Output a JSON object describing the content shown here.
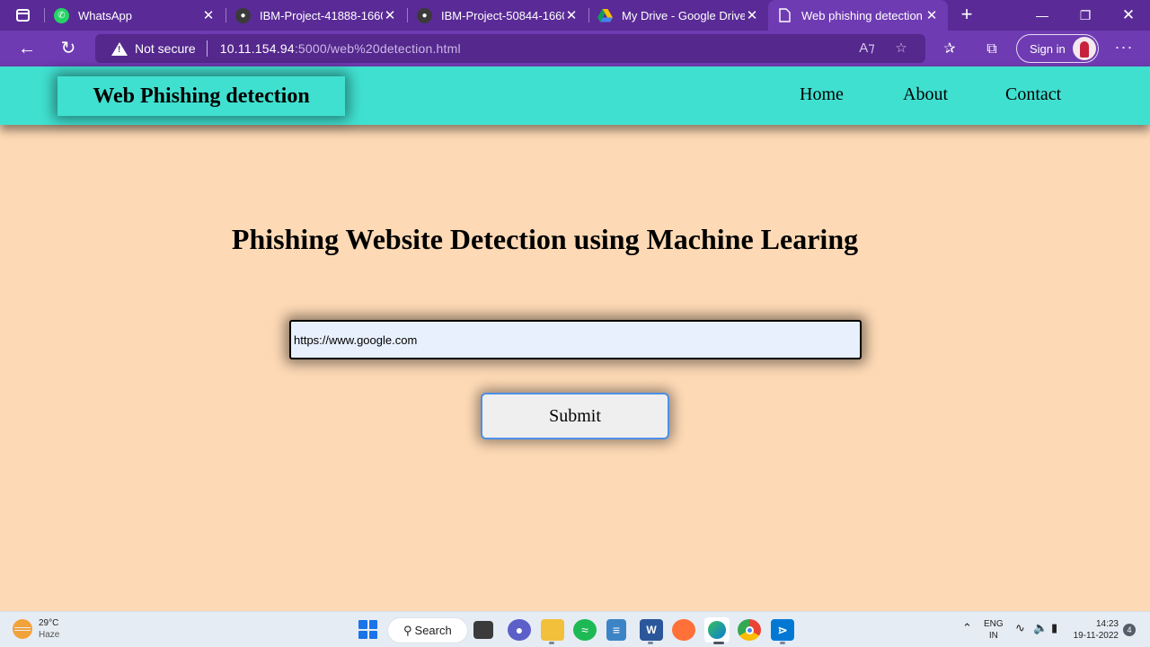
{
  "browser": {
    "tabs": [
      {
        "title": "WhatsApp",
        "icon": "whatsapp-icon",
        "color": "#25d366"
      },
      {
        "title": "IBM-Project-41888-1660",
        "icon": "github-icon",
        "color": "#333333"
      },
      {
        "title": "IBM-Project-50844-1660",
        "icon": "github-icon",
        "color": "#333333"
      },
      {
        "title": "My Drive - Google Drive",
        "icon": "google-drive-icon",
        "color": "#fbbc04"
      },
      {
        "title": "Web phishing detection",
        "icon": "document-icon",
        "color": "#ffffff"
      }
    ],
    "active_tab_index": 4,
    "address_bar": {
      "security_label": "Not secure",
      "url_host": "10.11.154.94",
      "url_path": ":5000/web%20detection.html"
    },
    "sign_in_label": "Sign in"
  },
  "page": {
    "brand": "Web Phishing detection",
    "nav": [
      "Home",
      "About",
      "Contact"
    ],
    "headline": "Phishing Website Detection using Machine Learing",
    "url_input_value": "https://www.google.com",
    "submit_label": "Submit",
    "colors": {
      "background": "#fdd9b5",
      "header": "#40e0d0",
      "browser_chrome": "#6f3bb2"
    }
  },
  "taskbar": {
    "weather_temp": "29°C",
    "weather_condition": "Haze",
    "search_label": "Search",
    "language": "ENG",
    "region": "IN",
    "time": "14:23",
    "date": "19-11-2022",
    "notification_count": "4"
  }
}
